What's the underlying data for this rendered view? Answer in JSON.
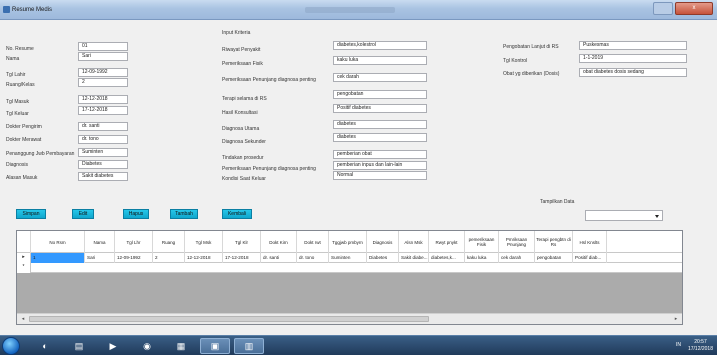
{
  "window": {
    "title": "Resume Medis",
    "close_glyph": "x"
  },
  "left": {
    "fields": [
      {
        "label": "No. Resume",
        "value": "01"
      },
      {
        "label": "Nama",
        "value": "Sari"
      },
      {
        "label": "Tgl Lahir",
        "value": "12-09-1992"
      },
      {
        "label": "Ruang/Kelas",
        "value": "2"
      },
      {
        "label": "Tgl Masuk",
        "value": "12-12-2018"
      },
      {
        "label": "Tgl Keluar",
        "value": "17-12-2018"
      },
      {
        "label": "Dokter Pengirim",
        "value": "dr. santi"
      },
      {
        "label": "Dokter Merawat",
        "value": "dr. tono"
      },
      {
        "label": "Penanggung Jwb Pembayaran",
        "value": "Suminten"
      },
      {
        "label": "Diagnosis",
        "value": "Diabetes"
      },
      {
        "label": "Alasan Masuk",
        "value": "Sakit diabetes"
      }
    ]
  },
  "middle": {
    "section_title": "Input Kriteria",
    "fields": [
      {
        "label": "Riwayat Penyakit",
        "value": "diabetes,kolestrol"
      },
      {
        "label": "Pemeriksaan Fisik",
        "value": "kaku luka"
      },
      {
        "label": "Pemeriksaan Penunjang diagnosa penting",
        "value": "cek darah"
      },
      {
        "label": "Terapi selama di RS",
        "value": "pengobatan"
      },
      {
        "label": "Hasil Konsultasi",
        "value": "Positif diabetes"
      },
      {
        "label": "Diagnosa Utama",
        "value": "diabetes"
      },
      {
        "label": "Diagnosa Sekunder",
        "value": "diabetes"
      },
      {
        "label": "Tindakan prosedur",
        "value": "pemberian obat"
      },
      {
        "label": "Pemeriksaan Penunjang diagnosa penting",
        "value": "pemberian inpus dan lain-lain"
      },
      {
        "label": "Kondisi Saat Keluar",
        "value": "Normal"
      }
    ]
  },
  "right": {
    "fields": [
      {
        "label": "Pengobatan Lanjut di RS",
        "value": "Puskesmas"
      },
      {
        "label": "Tgl Kontrol",
        "value": "1-1-2019"
      },
      {
        "label": "Obat yg diberikan (Dosis)",
        "value": "obat diabetes dosis sedang"
      }
    ]
  },
  "buttons": {
    "simpan": "Simpan",
    "edit": "Edit",
    "hapus": "Hapus",
    "tambah": "Tambah",
    "kembali": "Kembali"
  },
  "tampilkan": {
    "label": "Tampilkan Data",
    "value": ""
  },
  "table": {
    "columns": [
      "No Rsm",
      "Nama",
      "Tgl Lhr",
      "Ruang",
      "Tgl Msk",
      "Tgl Klr",
      "Dokt Kirn",
      "Dokt rwt",
      "Tggjwb pmbyrn",
      "Diagnosis",
      "Alsn Msk",
      "Rwyt pnykt",
      "pemeriksaan Fisik",
      "Pmriksaan Pnunjang",
      "Terapi pengbtn di Rs",
      "Hsl Knslts"
    ],
    "rows": [
      [
        "1",
        "Sari",
        "12-09-1992",
        "2",
        "12-12-2018",
        "17-12-2018",
        "dr. santi",
        "dr. tono",
        "Suminten",
        "Diabetes",
        "Sakit diabe...",
        "diabetes,k...",
        "kaku luka",
        "cek darah",
        "pengobatan",
        "Positif diab..."
      ]
    ],
    "row_marker": "▸",
    "new_row_marker": "*"
  },
  "taskbar": {
    "tray": "IN",
    "time": "20:57",
    "date": "17/12/2018"
  },
  "colors": {
    "button": "#0fa6cc",
    "selection": "#3399ff",
    "grid_bg": "#ababab"
  }
}
